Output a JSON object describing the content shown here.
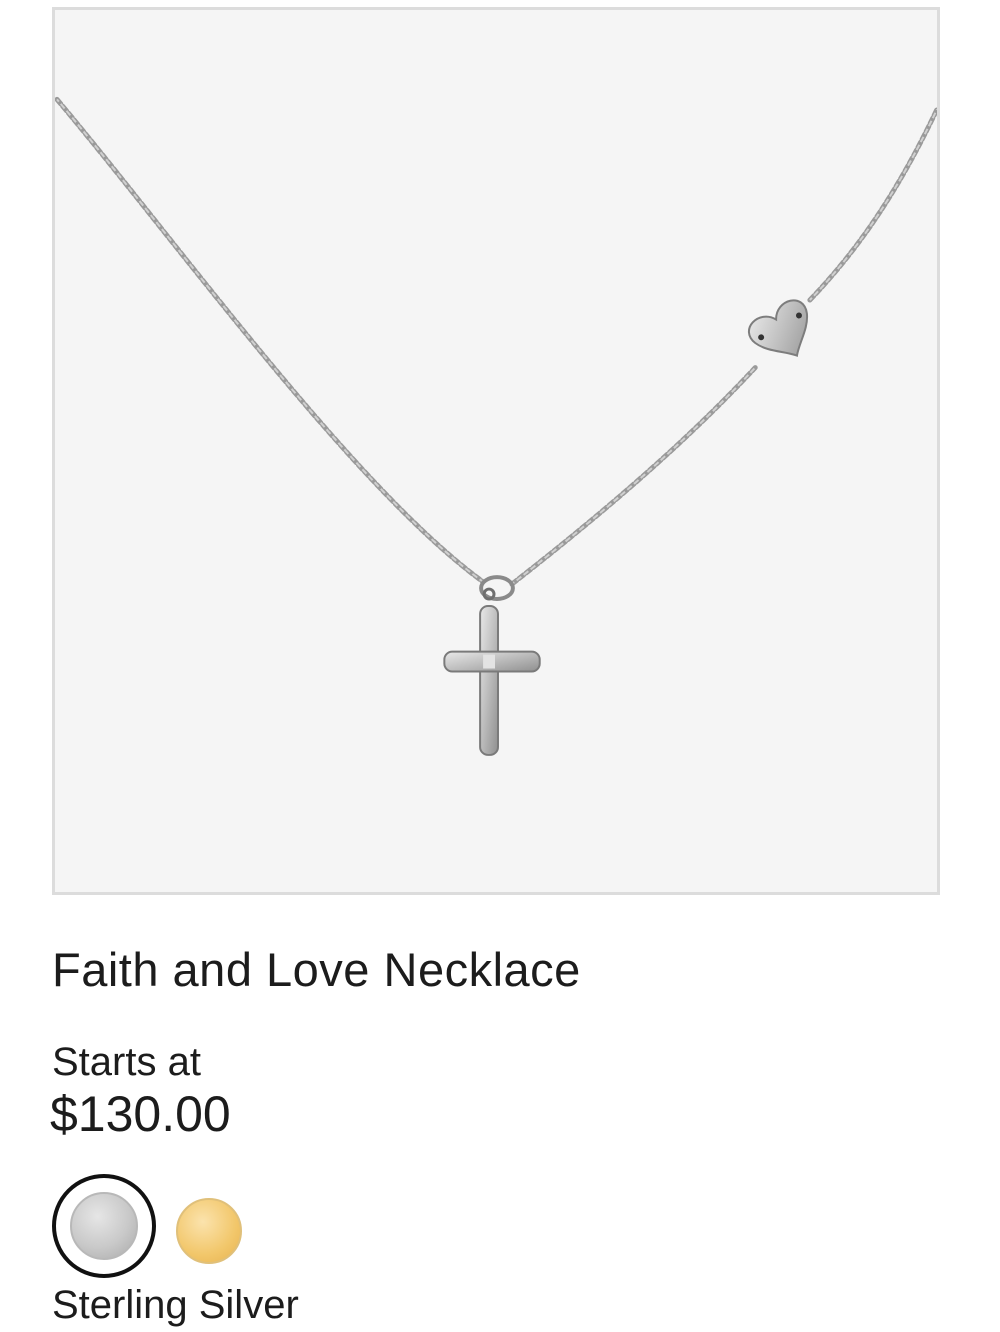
{
  "product": {
    "image_alt": "Faith and Love Necklace",
    "title": "Faith and Love Necklace",
    "price_prefix": "Starts at",
    "price": "$130.00",
    "selected_material": "Sterling Silver"
  },
  "swatches": [
    {
      "name": "silver",
      "color": "#c9c9c9",
      "selected": true
    },
    {
      "name": "gold",
      "color": "#f2c76b",
      "selected": false
    }
  ],
  "colors": {
    "image_background": "#f5f5f5",
    "frame_border": "#dcdcdc",
    "text": "#1c1c1c"
  }
}
